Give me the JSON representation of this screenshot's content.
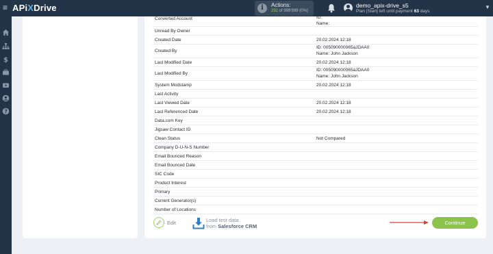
{
  "header": {
    "logo_left": "APi",
    "logo_x": "X",
    "logo_right": "Drive",
    "actions_label": "Actions:",
    "actions_used": "292",
    "actions_rest": " of 999'999 (0%)",
    "username": "demo_apix-drive_s5",
    "plan_prefix": "Plan |Start| left until payment ",
    "plan_days": "63",
    "plan_suffix": " days"
  },
  "sidebar_icons": [
    "home-icon",
    "sitemap-icon",
    "dollar-icon",
    "briefcase-icon",
    "video-icon",
    "user-circle-icon",
    "help-icon"
  ],
  "fields": [
    {
      "name": "Converted Account",
      "value": "ID:\nName:"
    },
    {
      "name": "Unread By Owner",
      "value": ""
    },
    {
      "name": "Created Date",
      "value": "20.02.2024 12:18"
    },
    {
      "name": "Created By",
      "value": "ID: 005090000065aJDAA0\nName: John Jackson"
    },
    {
      "name": "Last Modified Date",
      "value": "20.02.2024 12:18"
    },
    {
      "name": "Last Modified By",
      "value": "ID: 005090000065aJDAA0\nName: John Jackson"
    },
    {
      "name": "System Modstamp",
      "value": "20.02.2024 12:18"
    },
    {
      "name": "Last Activity",
      "value": ""
    },
    {
      "name": "Last Viewed Date",
      "value": "20.02.2024 12:18"
    },
    {
      "name": "Last Referenced Date",
      "value": "20.02.2024 12:18"
    },
    {
      "name": "Data.com Key",
      "value": ""
    },
    {
      "name": "Jigsaw Contact ID",
      "value": ""
    },
    {
      "name": "Clean Status",
      "value": "Not Compared"
    },
    {
      "name": "Company D-U-N-S Number",
      "value": ""
    },
    {
      "name": "Email Bounced Reason",
      "value": ""
    },
    {
      "name": "Email Bounced Date",
      "value": ""
    },
    {
      "name": "SIC Code",
      "value": ""
    },
    {
      "name": "Product Interest",
      "value": ""
    },
    {
      "name": "Primary",
      "value": ""
    },
    {
      "name": "Current Generator(s)",
      "value": ""
    },
    {
      "name": "Number of Locations",
      "value": ""
    }
  ],
  "footer": {
    "edit_label": "Edit",
    "load_line1": "Load test data",
    "load_from": "from ",
    "load_source": "Salesforce CRM",
    "continue_label": "Continue"
  },
  "colors": {
    "topbar": "#243448",
    "accent_green": "#8cc34b",
    "arrow_red": "#e03a3a",
    "link_blue": "#2f7fc6"
  }
}
